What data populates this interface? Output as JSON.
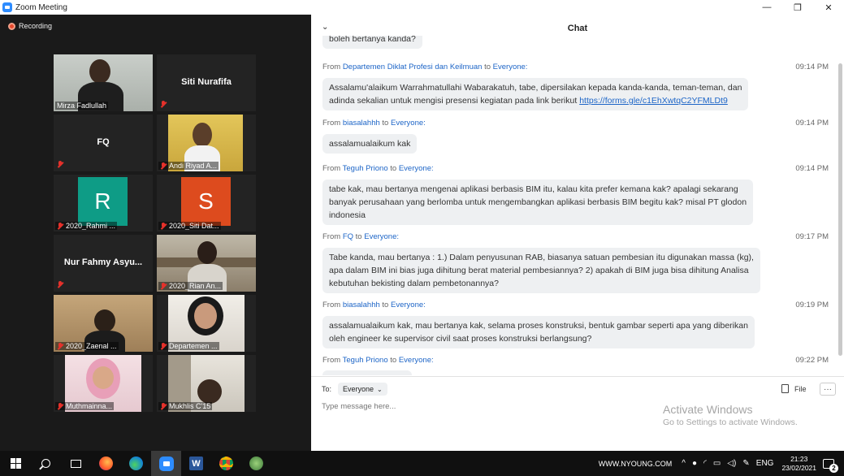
{
  "window": {
    "title": "Zoom Meeting",
    "minimize": "—",
    "restore": "❐",
    "close": "✕"
  },
  "recording": "Recording",
  "participants": [
    {
      "name": "Mirza Fadlullah",
      "kind": "video"
    },
    {
      "name": "Siti Nurafifa",
      "kind": "name"
    },
    {
      "name": "FQ",
      "kind": "name"
    },
    {
      "name": "Andi Riyad A...",
      "kind": "video"
    },
    {
      "name": "2020_Rahmi ...",
      "kind": "avatar",
      "initial": "R",
      "color": "#0e9c86"
    },
    {
      "name": "2020_Siti Dat...",
      "kind": "avatar",
      "initial": "S",
      "color": "#dd4b1e"
    },
    {
      "name": "Nur Fahmy Asyu...",
      "kind": "name"
    },
    {
      "name": "2020_Rian An...",
      "kind": "video"
    },
    {
      "name": "2020_Zaenal ...",
      "kind": "video"
    },
    {
      "name": "Departemen ...",
      "kind": "video"
    },
    {
      "name": "Muthmainna...",
      "kind": "video"
    },
    {
      "name": "Mukhlis C'15",
      "kind": "video"
    }
  ],
  "chat": {
    "title": "Chat",
    "collapse_icon": "chevron-down-icon",
    "partial_top": "boleh bertanya kanda?",
    "from_label": "From",
    "to_label": "to",
    "messages": [
      {
        "from": "Departemen Diklat Profesi dan Keilmuan",
        "to": "Everyone:",
        "time": "09:14 PM",
        "lines": [
          "Assalamu'alaikum Warrahmatullahi Wabarakatuh, tabe, dipersilakan kepada kanda-kanda, teman-teman, dan",
          "adinda sekalian untuk mengisi presensi kegiatan pada link berikut "
        ],
        "link": "https://forms.gle/c1EhXwtqC2YFMLDt9"
      },
      {
        "from": "biasalahhh",
        "to": "Everyone:",
        "time": "09:14 PM",
        "lines": [
          "assalamualaikum kak"
        ]
      },
      {
        "from": "Teguh Priono",
        "to": "Everyone:",
        "time": "09:14 PM",
        "lines": [
          "tabe kak, mau bertanya mengenai aplikasi berbasis BIM itu, kalau kita prefer kemana kak? apalagi sekarang",
          "banyak perusahaan yang berlomba untuk mengembangkan aplikasi berbasis BIM begitu kak? misal PT glodon",
          "indonesia"
        ]
      },
      {
        "from": "FQ",
        "to": "Everyone:",
        "time": "09:17 PM",
        "lines": [
          "Tabe kanda, mau bertanya : 1.) Dalam penyusunan RAB, biasanya satuan pembesian itu digunakan massa (kg),",
          "apa dalam BIM ini bias juga dihitung berat material pembesiannya? 2) apakah di BIM juga bisa dihitung Analisa",
          "kebutuhan bekisting dalam pembetonannya?"
        ]
      },
      {
        "from": "biasalahhh",
        "to": "Everyone:",
        "time": "09:19 PM",
        "lines": [
          "assalamualaikum kak, mau bertanya kak, selama proses konstruksi, bentuk gambar seperti apa yang diberikan",
          "oleh engineer ke supervisor civil saat proses konstruksi berlangsung?"
        ]
      },
      {
        "from": "Teguh Priono",
        "to": "Everyone:",
        "time": "09:22 PM",
        "lines": []
      }
    ],
    "to_prefix": "To:",
    "to_value": "Everyone",
    "file_label": "File",
    "more_label": "···",
    "input_placeholder": "Type message here..."
  },
  "activate": {
    "line1": "Activate Windows",
    "line2": "Go to Settings to activate Windows."
  },
  "taskbar": {
    "site": "WWW.NYOUNG.COM",
    "lang": "ENG",
    "time": "21:23",
    "date": "23/02/2021",
    "notification_count": "2"
  }
}
